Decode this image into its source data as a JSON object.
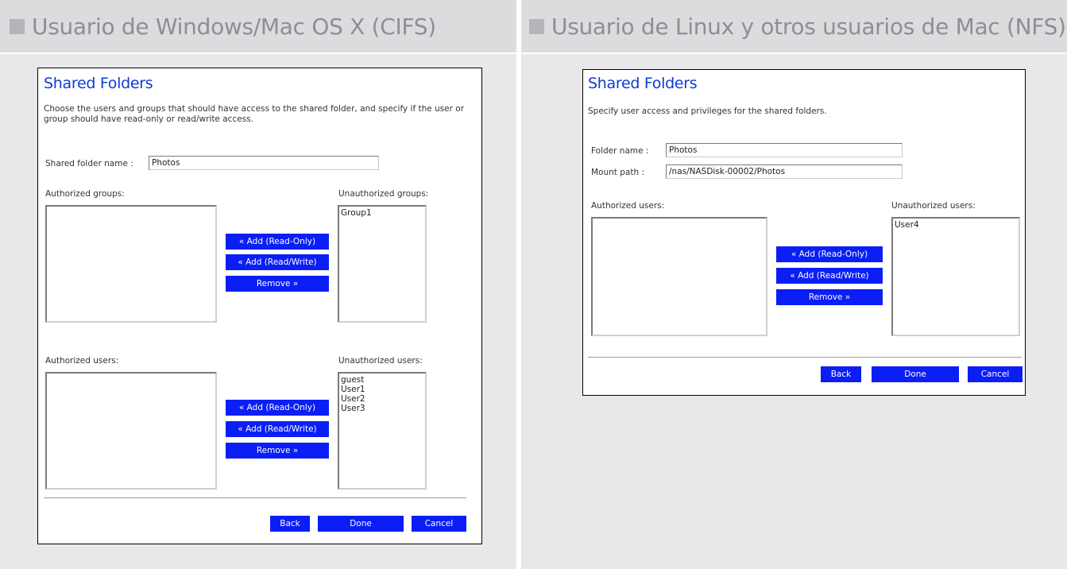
{
  "left": {
    "header": "Usuario de Windows/Mac OS X (CIFS)",
    "panel": {
      "title": "Shared Folders",
      "description": "Choose the users and groups that should have access to the shared folder, and specify if the user or group should have read-only or read/write access.",
      "folder_name_label": "Shared folder name   :",
      "folder_name_value": "Photos",
      "authorized_groups_label": "Authorized groups:",
      "unauthorized_groups_label": "Unauthorized groups:",
      "unauthorized_groups": [
        "Group1"
      ],
      "authorized_users_label": "Authorized users:",
      "unauthorized_users_label": "Unauthorized users:",
      "unauthorized_users": [
        "guest",
        "User1",
        "User2",
        "User3"
      ],
      "add_readonly": "« Add (Read-Only)",
      "add_readwrite": "« Add (Read/Write)",
      "remove": "Remove »",
      "back": "Back",
      "done": "Done",
      "cancel": "Cancel"
    }
  },
  "right": {
    "header": "Usuario de Linux y otros usuarios de Mac (NFS)",
    "panel": {
      "title": "Shared Folders",
      "description": "Specify user access and privileges for the shared folders.",
      "folder_name_label": "Folder name   :",
      "folder_name_value": "Photos",
      "mount_path_label": "Mount path    :",
      "mount_path_value": "/nas/NASDisk-00002/Photos",
      "authorized_users_label": "Authorized users:",
      "unauthorized_users_label": "Unauthorized users:",
      "unauthorized_users": [
        "User4"
      ],
      "add_readonly": "« Add (Read-Only)",
      "add_readwrite": "« Add (Read/Write)",
      "remove": "Remove »",
      "back": "Back",
      "done": "Done",
      "cancel": "Cancel"
    }
  },
  "colors": {
    "accent_button": "#0a1ef5",
    "title": "#0d3bd6",
    "header_bg": "#dcdcdf",
    "body_bg": "#e8e8ea"
  }
}
